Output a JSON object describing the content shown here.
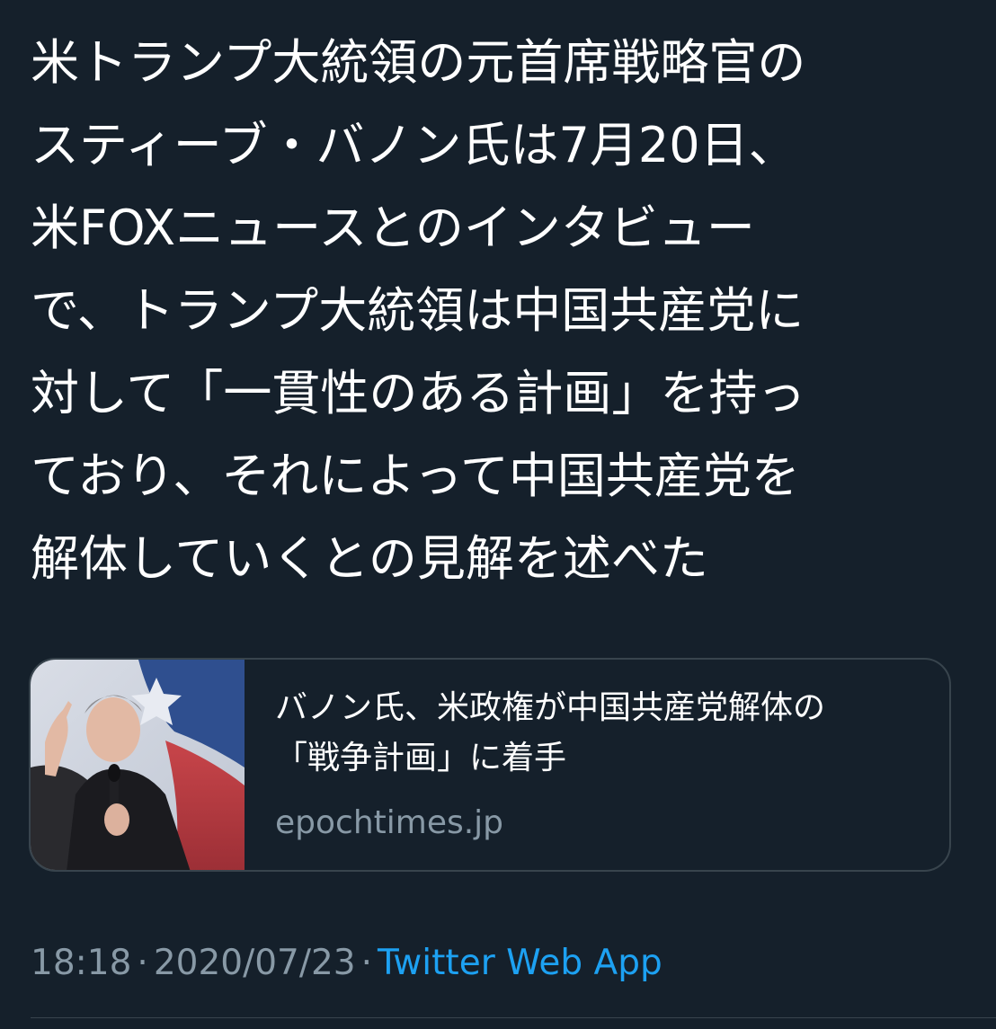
{
  "tweet": {
    "lines": [
      "米トランプ大統領の元首席戦略官の",
      "スティーブ・バノン氏は7月20日、",
      "米FOXニュースとのインタビュー",
      "で、トランプ大統領は中国共産党に",
      "対して「一貫性のある計画」を持っ",
      "ており、それによって中国共産党を",
      "解体していくとの見解を述べた"
    ]
  },
  "card": {
    "title_lines": [
      "バノン氏、米政権が中国共産党解体の",
      "「戦争計画」に着手"
    ],
    "domain": "epochtimes.jp",
    "thumbnail_icon": "photo-thumbnail"
  },
  "meta": {
    "time": "18:18",
    "separator": "·",
    "date": "2020/07/23",
    "source": "Twitter Web App"
  },
  "colors": {
    "background": "#15202b",
    "text": "#ffffff",
    "muted": "#8899a6",
    "link": "#1da1f2",
    "border": "#38444d"
  }
}
